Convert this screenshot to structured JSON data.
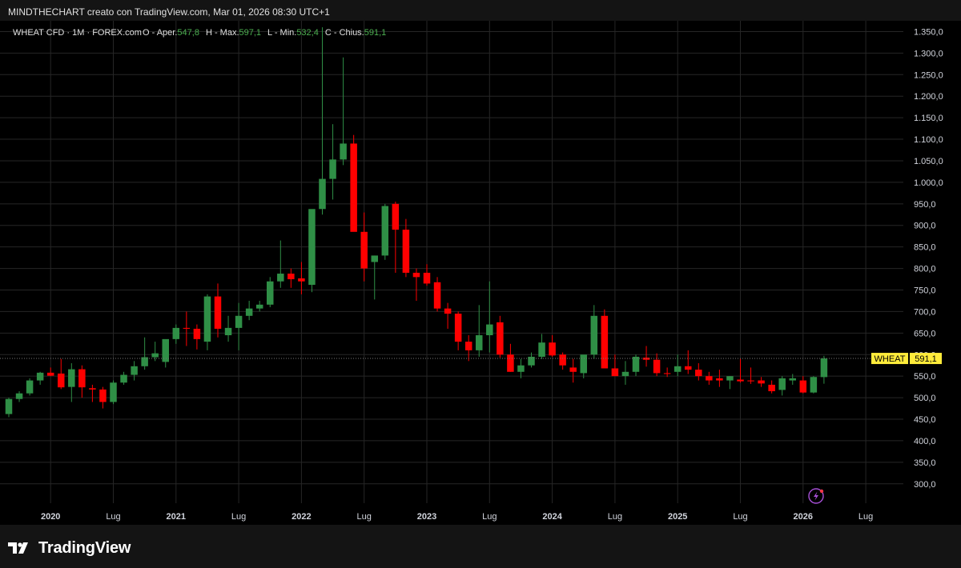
{
  "header": {
    "attribution": "MINDTHECHART creato con TradingView.com, Mar 01, 2026 08:30 UTC+1"
  },
  "legend": {
    "symbol": "WHEAT CFD · 1M · FOREX.com",
    "open_label": "O - Aper.",
    "open_value": "547,8",
    "high_label": "H - Max.",
    "high_value": "597,1",
    "low_label": "L - Min.",
    "low_value": "532,4",
    "close_label": "C - Chius.",
    "close_value": "591,1"
  },
  "price_tag": {
    "symbol": "WHEAT",
    "value": "591,1",
    "price": 591.1
  },
  "footer": {
    "brand": "TradingView"
  },
  "colors": {
    "background": "#000000",
    "page": "#141414",
    "grid": "#262626",
    "up": "#2f8f46",
    "down": "#ff0000",
    "tag": "#ffeb3b",
    "axis_text": "#d1d4dc",
    "legend_value": "#4caf50"
  },
  "chart_data": {
    "type": "candlestick",
    "timeframe": "1M",
    "y_range": [
      255,
      1375
    ],
    "y_ticks": [
      300,
      350,
      400,
      450,
      500,
      550,
      600,
      650,
      700,
      750,
      800,
      850,
      900,
      950,
      1000,
      1050,
      1100,
      1150,
      1200,
      1250,
      1300,
      1350
    ],
    "y_tick_labels": [
      "300,0",
      "350,0",
      "400,0",
      "450,0",
      "500,0",
      "550,0",
      "600,0",
      "650,0",
      "700,0",
      "750,0",
      "800,0",
      "850,0",
      "900,0",
      "950,0",
      "1.000,0",
      "1.050,0",
      "1.100,0",
      "1.150,0",
      "1.200,0",
      "1.250,0",
      "1.300,0",
      "1.350,0"
    ],
    "x_ticks": [
      {
        "label": "2020",
        "month_index": 4,
        "bold": true
      },
      {
        "label": "Lug",
        "month_index": 10,
        "bold": false
      },
      {
        "label": "2021",
        "month_index": 16,
        "bold": true
      },
      {
        "label": "Lug",
        "month_index": 22,
        "bold": false
      },
      {
        "label": "2022",
        "month_index": 28,
        "bold": true
      },
      {
        "label": "Lug",
        "month_index": 34,
        "bold": false
      },
      {
        "label": "2023",
        "month_index": 40,
        "bold": true
      },
      {
        "label": "Lug",
        "month_index": 46,
        "bold": false
      },
      {
        "label": "2024",
        "month_index": 52,
        "bold": true
      },
      {
        "label": "Lug",
        "month_index": 58,
        "bold": false
      },
      {
        "label": "2025",
        "month_index": 64,
        "bold": true
      },
      {
        "label": "Lug",
        "month_index": 70,
        "bold": false
      },
      {
        "label": "2026",
        "month_index": 76,
        "bold": true
      },
      {
        "label": "Lug",
        "month_index": 82,
        "bold": false
      }
    ],
    "candles": [
      {
        "date": "2019-08",
        "o": 462,
        "h": 500,
        "l": 455,
        "c": 497
      },
      {
        "date": "2019-09",
        "o": 497,
        "h": 515,
        "l": 490,
        "c": 510
      },
      {
        "date": "2019-10",
        "o": 510,
        "h": 545,
        "l": 505,
        "c": 540
      },
      {
        "date": "2019-11",
        "o": 540,
        "h": 560,
        "l": 530,
        "c": 558
      },
      {
        "date": "2019-12",
        "o": 558,
        "h": 570,
        "l": 550,
        "c": 551
      },
      {
        "date": "2020-01",
        "o": 556,
        "h": 590,
        "l": 520,
        "c": 524
      },
      {
        "date": "2020-02",
        "o": 525,
        "h": 580,
        "l": 490,
        "c": 566
      },
      {
        "date": "2020-03",
        "o": 566,
        "h": 575,
        "l": 500,
        "c": 524
      },
      {
        "date": "2020-04",
        "o": 522,
        "h": 530,
        "l": 490,
        "c": 519
      },
      {
        "date": "2020-05",
        "o": 519,
        "h": 525,
        "l": 475,
        "c": 490
      },
      {
        "date": "2020-06",
        "o": 490,
        "h": 540,
        "l": 485,
        "c": 535
      },
      {
        "date": "2020-07",
        "o": 535,
        "h": 560,
        "l": 530,
        "c": 553
      },
      {
        "date": "2020-08",
        "o": 553,
        "h": 585,
        "l": 540,
        "c": 573
      },
      {
        "date": "2020-09",
        "o": 573,
        "h": 640,
        "l": 565,
        "c": 594
      },
      {
        "date": "2020-10",
        "o": 594,
        "h": 630,
        "l": 585,
        "c": 603
      },
      {
        "date": "2020-11",
        "o": 583,
        "h": 615,
        "l": 570,
        "c": 636
      },
      {
        "date": "2020-12",
        "o": 636,
        "h": 670,
        "l": 625,
        "c": 662
      },
      {
        "date": "2021-01",
        "o": 662,
        "h": 700,
        "l": 620,
        "c": 660
      },
      {
        "date": "2021-02",
        "o": 660,
        "h": 670,
        "l": 612,
        "c": 636
      },
      {
        "date": "2021-03",
        "o": 630,
        "h": 740,
        "l": 610,
        "c": 735
      },
      {
        "date": "2021-04",
        "o": 735,
        "h": 765,
        "l": 640,
        "c": 660
      },
      {
        "date": "2021-05",
        "o": 645,
        "h": 690,
        "l": 630,
        "c": 662
      },
      {
        "date": "2021-06",
        "o": 662,
        "h": 720,
        "l": 610,
        "c": 690
      },
      {
        "date": "2021-07",
        "o": 690,
        "h": 725,
        "l": 680,
        "c": 707
      },
      {
        "date": "2021-08",
        "o": 707,
        "h": 725,
        "l": 700,
        "c": 716
      },
      {
        "date": "2021-09",
        "o": 716,
        "h": 780,
        "l": 710,
        "c": 770
      },
      {
        "date": "2021-10",
        "o": 770,
        "h": 865,
        "l": 755,
        "c": 788
      },
      {
        "date": "2021-11",
        "o": 788,
        "h": 800,
        "l": 755,
        "c": 775
      },
      {
        "date": "2021-12",
        "o": 777,
        "h": 815,
        "l": 740,
        "c": 770
      },
      {
        "date": "2022-01",
        "o": 762,
        "h": 800,
        "l": 745,
        "c": 938
      },
      {
        "date": "2022-02",
        "o": 938,
        "h": 1360,
        "l": 925,
        "c": 1008
      },
      {
        "date": "2022-03",
        "o": 1008,
        "h": 1135,
        "l": 960,
        "c": 1053
      },
      {
        "date": "2022-04",
        "o": 1053,
        "h": 1290,
        "l": 1040,
        "c": 1090
      },
      {
        "date": "2022-05",
        "o": 1090,
        "h": 1110,
        "l": 1060,
        "c": 885
      },
      {
        "date": "2022-06",
        "o": 885,
        "h": 930,
        "l": 770,
        "c": 800
      },
      {
        "date": "2022-07",
        "o": 815,
        "h": 830,
        "l": 728,
        "c": 830
      },
      {
        "date": "2022-08",
        "o": 830,
        "h": 950,
        "l": 820,
        "c": 945
      },
      {
        "date": "2022-09",
        "o": 950,
        "h": 955,
        "l": 790,
        "c": 890
      },
      {
        "date": "2022-10",
        "o": 890,
        "h": 915,
        "l": 780,
        "c": 790
      },
      {
        "date": "2022-11",
        "o": 790,
        "h": 800,
        "l": 725,
        "c": 780
      },
      {
        "date": "2022-12",
        "o": 790,
        "h": 810,
        "l": 760,
        "c": 765
      },
      {
        "date": "2023-01",
        "o": 768,
        "h": 780,
        "l": 700,
        "c": 707
      },
      {
        "date": "2023-02",
        "o": 707,
        "h": 720,
        "l": 660,
        "c": 695
      },
      {
        "date": "2023-03",
        "o": 695,
        "h": 700,
        "l": 610,
        "c": 630
      },
      {
        "date": "2023-04",
        "o": 630,
        "h": 645,
        "l": 585,
        "c": 610
      },
      {
        "date": "2023-05",
        "o": 610,
        "h": 715,
        "l": 595,
        "c": 645
      },
      {
        "date": "2023-06",
        "o": 645,
        "h": 770,
        "l": 605,
        "c": 670
      },
      {
        "date": "2023-07",
        "o": 675,
        "h": 690,
        "l": 593,
        "c": 600
      },
      {
        "date": "2023-08",
        "o": 600,
        "h": 625,
        "l": 560,
        "c": 560
      },
      {
        "date": "2023-09",
        "o": 560,
        "h": 590,
        "l": 545,
        "c": 575
      },
      {
        "date": "2023-10",
        "o": 575,
        "h": 605,
        "l": 570,
        "c": 595
      },
      {
        "date": "2023-11",
        "o": 595,
        "h": 648,
        "l": 590,
        "c": 628
      },
      {
        "date": "2023-12",
        "o": 628,
        "h": 645,
        "l": 595,
        "c": 598
      },
      {
        "date": "2024-01",
        "o": 600,
        "h": 605,
        "l": 565,
        "c": 575
      },
      {
        "date": "2024-02",
        "o": 570,
        "h": 590,
        "l": 535,
        "c": 560
      },
      {
        "date": "2024-03",
        "o": 557,
        "h": 590,
        "l": 545,
        "c": 600
      },
      {
        "date": "2024-04",
        "o": 600,
        "h": 715,
        "l": 590,
        "c": 690
      },
      {
        "date": "2024-05",
        "o": 690,
        "h": 705,
        "l": 590,
        "c": 568
      },
      {
        "date": "2024-06",
        "o": 568,
        "h": 600,
        "l": 550,
        "c": 550
      },
      {
        "date": "2024-07",
        "o": 550,
        "h": 585,
        "l": 530,
        "c": 560
      },
      {
        "date": "2024-08",
        "o": 560,
        "h": 600,
        "l": 550,
        "c": 595
      },
      {
        "date": "2024-09",
        "o": 593,
        "h": 620,
        "l": 572,
        "c": 588
      },
      {
        "date": "2024-10",
        "o": 588,
        "h": 603,
        "l": 550,
        "c": 557
      },
      {
        "date": "2024-11",
        "o": 557,
        "h": 570,
        "l": 548,
        "c": 555
      },
      {
        "date": "2024-12",
        "o": 560,
        "h": 600,
        "l": 550,
        "c": 573
      },
      {
        "date": "2025-01",
        "o": 573,
        "h": 610,
        "l": 555,
        "c": 565
      },
      {
        "date": "2025-02",
        "o": 565,
        "h": 580,
        "l": 540,
        "c": 550
      },
      {
        "date": "2025-03",
        "o": 550,
        "h": 560,
        "l": 530,
        "c": 540
      },
      {
        "date": "2025-04",
        "o": 545,
        "h": 565,
        "l": 525,
        "c": 540
      },
      {
        "date": "2025-05",
        "o": 540,
        "h": 550,
        "l": 520,
        "c": 550
      },
      {
        "date": "2025-06",
        "o": 542,
        "h": 590,
        "l": 535,
        "c": 538
      },
      {
        "date": "2025-07",
        "o": 540,
        "h": 570,
        "l": 532,
        "c": 538
      },
      {
        "date": "2025-08",
        "o": 540,
        "h": 548,
        "l": 525,
        "c": 533
      },
      {
        "date": "2025-09",
        "o": 530,
        "h": 540,
        "l": 510,
        "c": 515
      },
      {
        "date": "2025-10",
        "o": 518,
        "h": 550,
        "l": 505,
        "c": 545
      },
      {
        "date": "2025-11",
        "o": 540,
        "h": 555,
        "l": 530,
        "c": 545
      },
      {
        "date": "2025-12",
        "o": 540,
        "h": 550,
        "l": 510,
        "c": 512
      },
      {
        "date": "2026-01",
        "o": 512,
        "h": 550,
        "l": 510,
        "c": 548
      },
      {
        "date": "2026-02",
        "o": 547.8,
        "h": 597.1,
        "l": 532.4,
        "c": 591.1
      }
    ]
  }
}
